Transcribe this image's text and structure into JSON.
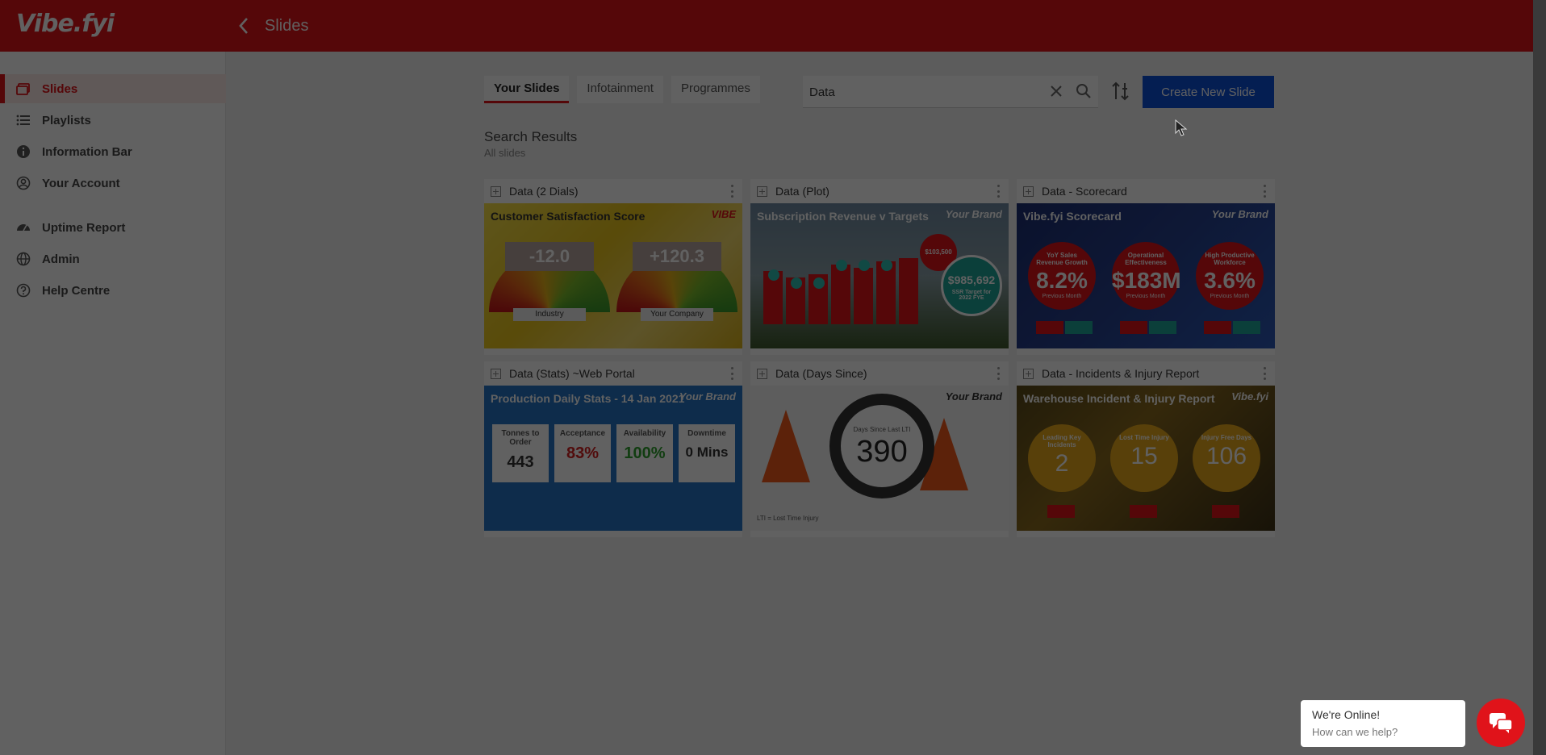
{
  "header": {
    "logo": "Vibe.fyi",
    "title": "Slides",
    "back_icon": "chevron-left-icon",
    "accent_color": "#e0131a"
  },
  "sidebar": {
    "items": [
      {
        "label": "Slides",
        "icon": "slides-icon",
        "active": true
      },
      {
        "label": "Playlists",
        "icon": "list-icon"
      },
      {
        "label": "Information Bar",
        "icon": "info-icon"
      },
      {
        "label": "Your Account",
        "icon": "account-icon"
      },
      {
        "label": "Uptime Report",
        "icon": "uptime-icon"
      },
      {
        "label": "Admin",
        "icon": "globe-icon"
      },
      {
        "label": "Help Centre",
        "icon": "help-icon"
      }
    ]
  },
  "tabs": [
    {
      "label": "Your Slides",
      "active": true
    },
    {
      "label": "Infotainment"
    },
    {
      "label": "Programmes"
    }
  ],
  "search": {
    "value": "Data",
    "clear_icon": "close-icon",
    "search_icon": "search-icon",
    "sort_icon": "sort-icon"
  },
  "create_button": {
    "label": "Create New Slide",
    "color": "#0d4fd8"
  },
  "results": {
    "title": "Search Results",
    "subtitle": "All slides"
  },
  "cards": [
    {
      "title": "Data (2 Dials)",
      "thumb_title": "Customer Satisfaction Score",
      "brand": "VIBE",
      "dials": [
        {
          "value": "-12.0",
          "label": "Industry"
        },
        {
          "value": "+120.3",
          "label": "Your Company"
        }
      ]
    },
    {
      "title": "Data (Plot)",
      "thumb_title": "Subscription Revenue v Targets",
      "brand": "Your Brand",
      "bubble_small": "$103,500",
      "bubble_big_value": "$985,692",
      "bubble_big_label": "SSR Target for 2022 FYE"
    },
    {
      "title": "Data - Scorecard",
      "thumb_title": "Vibe.fyi Scorecard",
      "brand": "Your Brand",
      "scores": [
        {
          "label": "YoY Sales Revenue Growth",
          "value": "8.2%",
          "sub": "Previous Month"
        },
        {
          "label": "Operational Effectiveness",
          "value": "$183M",
          "sub": "Previous Month"
        },
        {
          "label": "High Productive Workforce",
          "value": "3.6%",
          "sub": "Previous Month"
        }
      ]
    },
    {
      "title": "Data (Stats) ~Web Portal",
      "thumb_title": "Production Daily Stats - 14 Jan 2021",
      "brand": "Your Brand",
      "stats": [
        {
          "label": "Tonnes to Order",
          "value": "443",
          "color": "#333333"
        },
        {
          "label": "Acceptance",
          "value": "83%",
          "color": "#d42020"
        },
        {
          "label": "Availability",
          "value": "100%",
          "color": "#2fa12f"
        },
        {
          "label": "Downtime",
          "value": "0 Mins",
          "color": "#333333"
        }
      ]
    },
    {
      "title": "Data (Days Since)",
      "brand": "Your Brand",
      "ring_label": "Days Since Last LTI",
      "ring_value": "390",
      "footer": "LTI = Lost Time Injury"
    },
    {
      "title": "Data - Incidents & Injury Report",
      "thumb_title": "Warehouse Incident & Injury Report",
      "brand": "Vibe.fyi",
      "coins": [
        {
          "label": "Leading Key Incidents",
          "value": "2"
        },
        {
          "label": "Lost Time Injury",
          "value": "15"
        },
        {
          "label": "Injury Free Days",
          "value": "106"
        }
      ]
    }
  ],
  "chat": {
    "title": "We're Online!",
    "subtitle": "How can we help?",
    "icon": "chat-icon"
  }
}
